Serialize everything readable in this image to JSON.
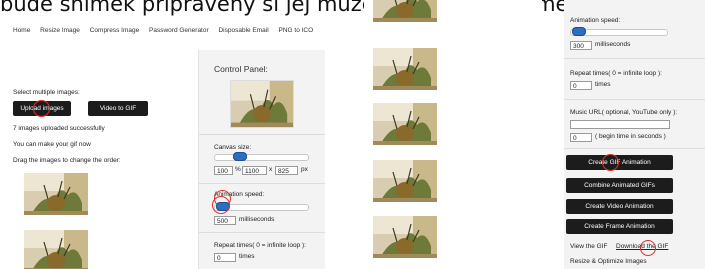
{
  "banner": "bude snímek připravený si jej můžete stáhnout do mé",
  "nav": [
    "Home",
    "Resize Image",
    "Compress Image",
    "Password Generator",
    "Disposable Email",
    "PNG to ICO"
  ],
  "left": {
    "select_label": "Select multiple images:",
    "upload_button": "Upload images",
    "video_button": "Video to GIF",
    "uploaded_msg": "7 images uploaded successfully",
    "make_gif_msg": "You can make your gif now",
    "drag_msg": "Drag the images to change the order:"
  },
  "control": {
    "title": "Control Panel:",
    "canvas_label": "Canvas size:",
    "canvas_percent": "100",
    "percent_sign": "%",
    "canvas_width": "1100",
    "x_sign": "x",
    "canvas_height": "825",
    "px_unit": "px",
    "canvas_slider_level": 0.3,
    "speed_label": "Animation speed:",
    "speed_value": "500",
    "speed_unit": "milliseconds",
    "speed_slider_level": 0.05,
    "repeat_label": "Repeat times( 0 = infinite loop ):",
    "repeat_value": "0",
    "repeat_unit": "times"
  },
  "controlC": {
    "speed_label": "Animation speed:",
    "speed_value": "300",
    "speed_unit": "milliseconds",
    "speed_slider_level": 0.03,
    "repeat_label": "Repeat times( 0 = infinite loop ):",
    "repeat_value": "0",
    "repeat_unit": "times",
    "music_label": "Music URL( optional, YouTube only ):",
    "music_value": "",
    "music_time_value": "0",
    "music_time_unit": "( begin time in seconds )",
    "btn_create_gif": "Create GIF Animation",
    "btn_combine": "Combine Animated GIFs",
    "btn_video": "Create Video Animation",
    "btn_frame": "Create Frame Animation",
    "view_gif": "View the GIF",
    "download_gif": "Download the GIF",
    "resize_opt": "Resize & Optimize Images"
  },
  "colors": {
    "button_bg": "#1c1c1c",
    "panel_bg": "#f3f3f3",
    "highlight_circle": "#e03030",
    "slider_knob": "#2a6fc0"
  }
}
